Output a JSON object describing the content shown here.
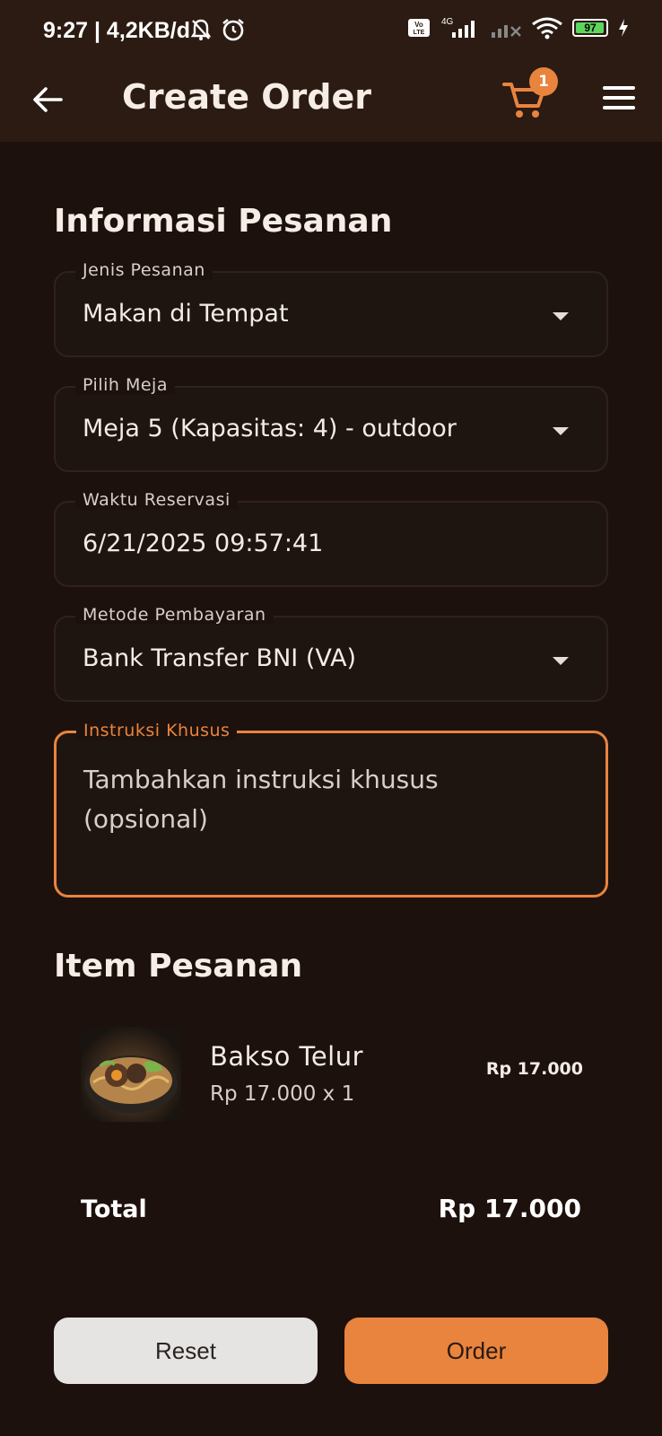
{
  "status_bar": {
    "time": "9:27 | 4,2KB/d",
    "battery": "97"
  },
  "app_bar": {
    "title": "Create Order",
    "cart_count": "1"
  },
  "order_info": {
    "section_title": "Informasi Pesanan",
    "order_type": {
      "label": "Jenis Pesanan",
      "value": "Makan di Tempat"
    },
    "table": {
      "label": "Pilih Meja",
      "value": "Meja 5 (Kapasitas: 4) - outdoor"
    },
    "reservation_time": {
      "label": "Waktu Reservasi",
      "value": "6/21/2025 09:57:41"
    },
    "payment_method": {
      "label": "Metode Pembayaran",
      "value": "Bank Transfer BNI (VA)"
    },
    "special_instructions": {
      "label": "Instruksi Khusus",
      "placeholder": "Tambahkan instruksi khusus (opsional)"
    }
  },
  "order_items": {
    "section_title": "Item Pesanan",
    "items": [
      {
        "name": "Bakso Telur",
        "qty_text": "Rp 17.000 x 1",
        "price": "Rp 17.000"
      }
    ],
    "total_label": "Total",
    "total_value": "Rp 17.000"
  },
  "actions": {
    "reset_label": "Reset",
    "order_label": "Order"
  },
  "colors": {
    "accent": "#e8843e",
    "background": "#1c110c",
    "appbar": "#2b1b12"
  }
}
